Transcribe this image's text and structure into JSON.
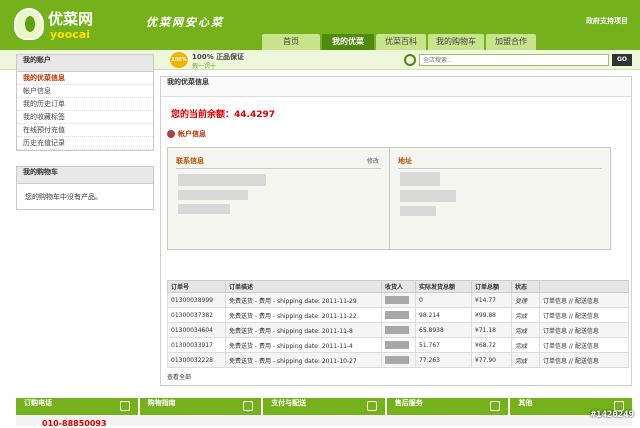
{
  "header": {
    "logo_cn": "优菜网",
    "logo_en": "yoocai",
    "slogan": "优菜网安心菜",
    "top_link": "政府支持项目",
    "nav": [
      "首页",
      "我的优菜",
      "优菜百科",
      "我的购物车",
      "加盟合作"
    ],
    "nav_active": 1
  },
  "subbar": {
    "badge": "100%",
    "guarantee": "100% 正品保证",
    "guarantee_sub": "假一罚十",
    "search_placeholder": "全店搜索...",
    "go_label": "GO"
  },
  "sidebar": {
    "account_title": "我的账户",
    "items": [
      "我的优菜信息",
      "帐户信息",
      "我的历史订单",
      "我的收藏标签",
      "在线预付充值",
      "历史充值记录"
    ],
    "selected": 0,
    "cart_title": "我的购物车",
    "cart_empty": "您的购物车中没有产品。"
  },
  "main": {
    "header": "我的优菜信息",
    "balance_label": "您的当前余额：",
    "balance_value": "44.4297",
    "account_info": "帐户信息",
    "contact_title": "联系信息",
    "edit": "修改",
    "address_title": "地址",
    "orders_table": {
      "headers": [
        "订单号",
        "订单描述",
        "收货人",
        "实际发货总额",
        "订单总额",
        "状态",
        ""
      ],
      "rows": [
        [
          "01300038999",
          "免费送货 - 费用 - shipping date: 2011-11-29",
          "",
          "0",
          "¥14.77",
          "受理",
          "订单信息 // 配送信息"
        ],
        [
          "01300037382",
          "免费送货 - 费用 - shipping date: 2011-11-22",
          "",
          "98.214",
          "¥99.88",
          "完成",
          "订单信息 // 配送信息"
        ],
        [
          "01300034604",
          "免费送货 - 费用 - shipping date: 2011-11-8",
          "",
          "65.8938",
          "¥71.18",
          "完成",
          "订单信息 // 配送信息"
        ],
        [
          "01300033917",
          "免费送货 - 费用 - shipping date: 2011-11-4",
          "",
          "51.767",
          "¥68.72",
          "完成",
          "订单信息 // 配送信息"
        ],
        [
          "01300032228",
          "免费送货 - 费用 - shipping date: 2011-10-27",
          "",
          "77.263",
          "¥77.90",
          "完成",
          "订单信息 // 配送信息"
        ]
      ]
    },
    "view_all": "查看全部"
  },
  "footer": {
    "sections": [
      "订购电话",
      "购物指南",
      "支付与配送",
      "售后服务",
      "其他"
    ],
    "phone": "010-88850093"
  },
  "watermark": "#1420249"
}
